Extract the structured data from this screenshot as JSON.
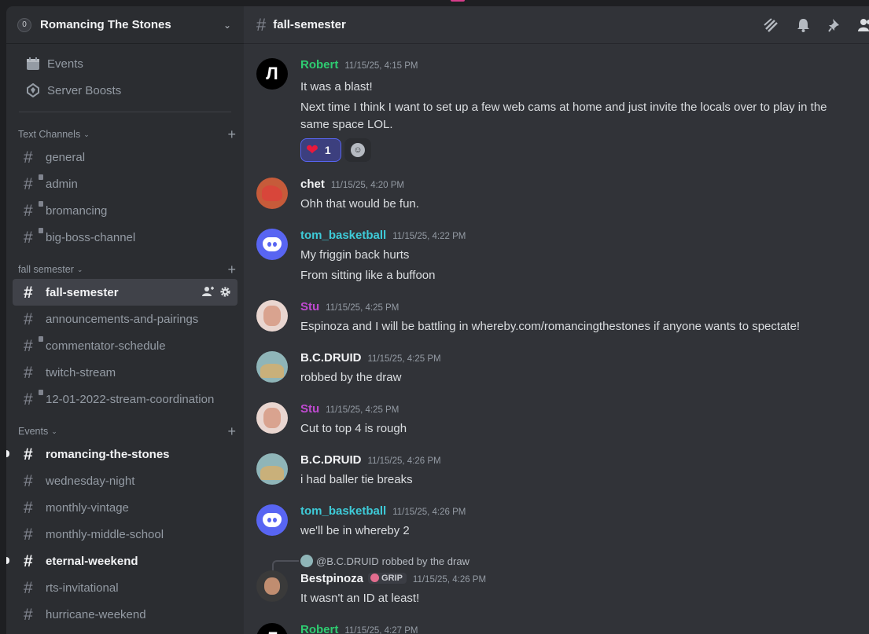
{
  "server": {
    "name": "Romancing The Stones",
    "icon_text": "0"
  },
  "sidebar_top": [
    {
      "label": "Events",
      "icon": "calendar-icon"
    },
    {
      "label": "Server Boosts",
      "icon": "boost-icon"
    }
  ],
  "categories": [
    {
      "name": "Text Channels",
      "channels": [
        {
          "name": "general",
          "locked": false
        },
        {
          "name": "admin",
          "locked": true
        },
        {
          "name": "bromancing",
          "locked": true
        },
        {
          "name": "big-boss-channel",
          "locked": true
        }
      ]
    },
    {
      "name": "fall semester",
      "channels": [
        {
          "name": "fall-semester",
          "active": true
        },
        {
          "name": "announcements-and-pairings"
        },
        {
          "name": "commentator-schedule",
          "locked": true
        },
        {
          "name": "twitch-stream"
        },
        {
          "name": "12-01-2022-stream-coordination",
          "locked": true
        }
      ]
    },
    {
      "name": "Events",
      "channels": [
        {
          "name": "romancing-the-stones",
          "unread": true
        },
        {
          "name": "wednesday-night"
        },
        {
          "name": "monthly-vintage"
        },
        {
          "name": "monthly-middle-school"
        },
        {
          "name": "eternal-weekend",
          "unread": true
        },
        {
          "name": "rts-invitational"
        },
        {
          "name": "hurricane-weekend"
        }
      ]
    }
  ],
  "channel_header": {
    "title": "fall-semester"
  },
  "messages": {
    "m1": {
      "author": "Robert",
      "ts": "11/15/25, 4:15 PM",
      "lines": [
        "It was a blast!",
        "Next time I think I want to set up a few web cams at home and just invite the locals over to play in the",
        "same space LOL."
      ],
      "reaction_count": "1"
    },
    "m2": {
      "author": "chet",
      "ts": "11/15/25, 4:20 PM",
      "lines": [
        "Ohh that would be fun."
      ]
    },
    "m3": {
      "author": "tom_basketball",
      "ts": "11/15/25, 4:22 PM",
      "lines": [
        "My friggin back hurts",
        "From sitting like a buffoon"
      ]
    },
    "m4": {
      "author": "Stu",
      "ts": "11/15/25, 4:25 PM",
      "lines": [
        "Espinoza and I will be battling in whereby.com/romancingthestones if anyone wants to spectate!"
      ]
    },
    "m5": {
      "author": "B.C.DRUID",
      "ts": "11/15/25, 4:25 PM",
      "lines": [
        "robbed by the draw"
      ]
    },
    "m6": {
      "author": "Stu",
      "ts": "11/15/25, 4:25 PM",
      "lines": [
        "Cut to top 4 is rough"
      ]
    },
    "m7": {
      "author": "B.C.DRUID",
      "ts": "11/15/25, 4:26 PM",
      "lines": [
        "i had baller tie breaks"
      ]
    },
    "m8": {
      "author": "tom_basketball",
      "ts": "11/15/25, 4:26 PM",
      "lines": [
        "we'll be in whereby 2"
      ]
    },
    "m9": {
      "author": "Bestpinoza",
      "tag": "GRIP",
      "ts": "11/15/25, 4:26 PM",
      "lines": [
        "It wasn't an ID at least!"
      ],
      "reply_mention": "@B.C.DRUID",
      "reply_text": "robbed by the draw"
    },
    "m10": {
      "author": "Robert",
      "ts": "11/15/25, 4:27 PM"
    }
  }
}
